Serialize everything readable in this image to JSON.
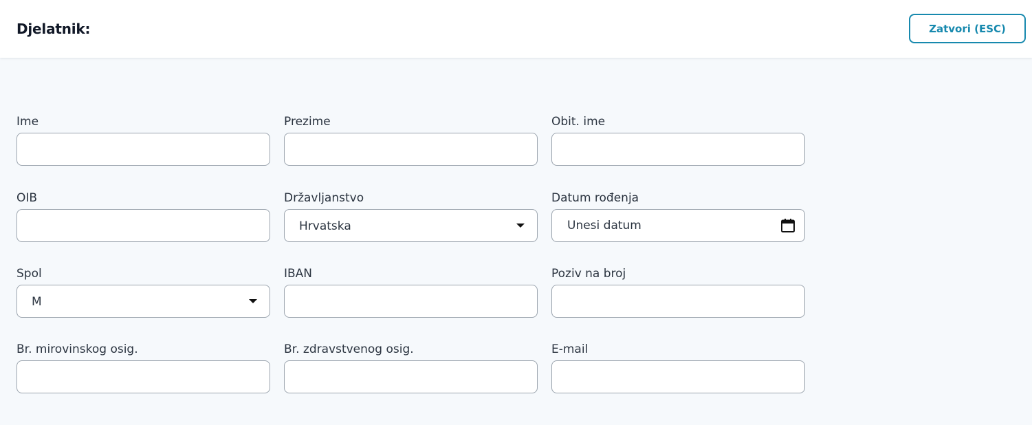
{
  "header": {
    "title": "Djelatnik:",
    "close_label": "Zatvori (ESC)"
  },
  "fields": {
    "ime": {
      "label": "Ime",
      "value": ""
    },
    "prezime": {
      "label": "Prezime",
      "value": ""
    },
    "obit_ime": {
      "label": "Obit. ime",
      "value": ""
    },
    "oib": {
      "label": "OIB",
      "value": ""
    },
    "drzavljanstvo": {
      "label": "Državljanstvo",
      "value": "Hrvatska"
    },
    "datum_rodenja": {
      "label": "Datum rođenja",
      "placeholder": "Unesi datum"
    },
    "spol": {
      "label": "Spol",
      "value": "M"
    },
    "iban": {
      "label": "IBAN",
      "value": ""
    },
    "poziv_na_broj": {
      "label": "Poziv na broj",
      "value": ""
    },
    "br_mirovinskog": {
      "label": "Br. mirovinskog osig.",
      "value": ""
    },
    "br_zdravstvenog": {
      "label": "Br. zdravstvenog osig.",
      "value": ""
    },
    "email": {
      "label": "E-mail",
      "value": ""
    }
  },
  "icons": {
    "dropdown": "caret-down-icon",
    "date": "calendar-icon"
  },
  "colors": {
    "accent": "#1789ae",
    "background": "#f6f9fc",
    "border": "#9aa3ad"
  }
}
